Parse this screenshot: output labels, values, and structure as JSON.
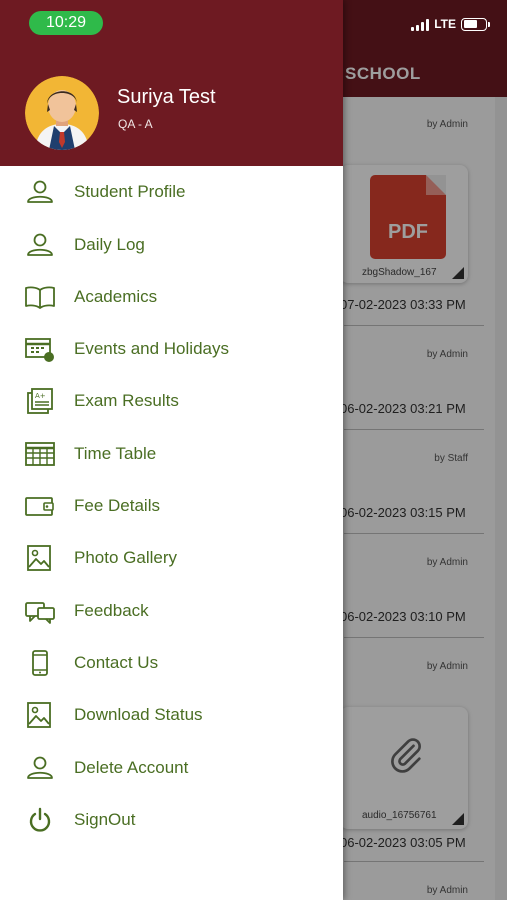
{
  "status_bar": {
    "time": "10:29",
    "network": "LTE"
  },
  "background": {
    "header_title": "SCHOOL",
    "feed": [
      {
        "by": "by Admin",
        "attachment": "zbgShadow_167",
        "attachment_type": "pdf",
        "pdf_label": "PDF",
        "date": "07-02-2023 03:33 PM"
      },
      {
        "by": "by Admin",
        "date": "06-02-2023 03:21 PM"
      },
      {
        "by": "by Staff",
        "date": "06-02-2023 03:15 PM"
      },
      {
        "by": "by Admin",
        "date": "06-02-2023 03:10 PM"
      },
      {
        "by": "by Admin",
        "attachment": "audio_16756761",
        "attachment_type": "paperclip",
        "date": "06-02-2023 03:05 PM"
      },
      {
        "by": "by Admin"
      }
    ]
  },
  "drawer": {
    "user": {
      "name": "Suriya Test",
      "class": "QA - A"
    },
    "menu": [
      {
        "label": "Student Profile",
        "icon": "person-icon"
      },
      {
        "label": "Daily Log",
        "icon": "person-icon"
      },
      {
        "label": "Academics",
        "icon": "open-book-icon"
      },
      {
        "label": "Events and Holidays",
        "icon": "calendar-event-icon"
      },
      {
        "label": "Exam Results",
        "icon": "results-doc-icon"
      },
      {
        "label": "Time Table",
        "icon": "calendar-grid-icon"
      },
      {
        "label": "Fee Details",
        "icon": "wallet-icon"
      },
      {
        "label": "Photo Gallery",
        "icon": "image-icon"
      },
      {
        "label": "Feedback",
        "icon": "chat-bubbles-icon"
      },
      {
        "label": "Contact Us",
        "icon": "mobile-phone-icon"
      },
      {
        "label": "Download Status",
        "icon": "image-icon"
      },
      {
        "label": "Delete Account",
        "icon": "person-icon"
      },
      {
        "label": "SignOut",
        "icon": "power-icon"
      }
    ]
  },
  "colors": {
    "primary": "#6e1a22",
    "menu_text": "#4a6e23",
    "status_pill": "#2fba4a",
    "pdf_red": "#d9412f"
  }
}
